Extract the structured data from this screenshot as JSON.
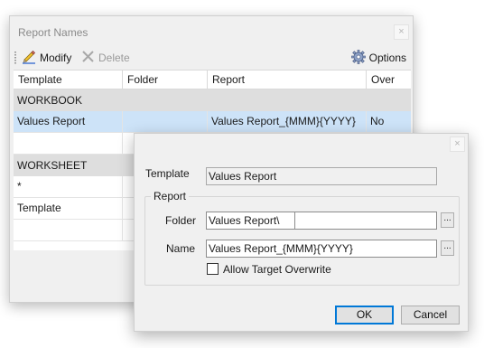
{
  "report_names_window": {
    "title": "Report Names",
    "close_glyph": "×",
    "toolbar": {
      "modify_label": "Modify",
      "delete_label": "Delete",
      "options_label": "Options"
    },
    "columns": [
      "Template",
      "Folder",
      "Report",
      "Over"
    ],
    "groups": [
      {
        "label": "WORKBOOK",
        "rows": [
          {
            "template": "Values Report",
            "folder": "",
            "report": "Values Report_{MMM}{YYYY}",
            "overwrite": "No",
            "selected": true
          },
          {
            "template": "",
            "folder": "",
            "report": "",
            "overwrite": "",
            "selected": false
          }
        ]
      },
      {
        "label": "WORKSHEET",
        "rows": [
          {
            "template": "*",
            "folder": "",
            "report": "",
            "overwrite": "",
            "selected": false
          },
          {
            "template": "Template",
            "folder": "",
            "report": "",
            "overwrite": "",
            "selected": false
          },
          {
            "template": "",
            "folder": "",
            "report": "",
            "overwrite": "",
            "selected": false
          }
        ]
      }
    ]
  },
  "dialog": {
    "close_glyph": "×",
    "template_label": "Template",
    "template_value": "Values Report",
    "report_group_label": "Report",
    "folder_label": "Folder",
    "folder_value": "Values Report\\",
    "folder_extra_value": "",
    "folder_browse_label": "...",
    "name_label": "Name",
    "name_value": "Values Report_{MMM}{YYYY}",
    "name_browse_label": "...",
    "allow_overwrite_label": "Allow Target Overwrite",
    "allow_overwrite_checked": false,
    "ok_label": "OK",
    "cancel_label": "Cancel"
  },
  "icons": {
    "modify": "pencil-icon",
    "delete": "delete-x-icon",
    "options": "gear-icon"
  },
  "colors": {
    "selection": "#cde3f8",
    "group_header": "#dedede",
    "default_button_border": "#0078d7",
    "window_background": "#f0f0f0"
  }
}
